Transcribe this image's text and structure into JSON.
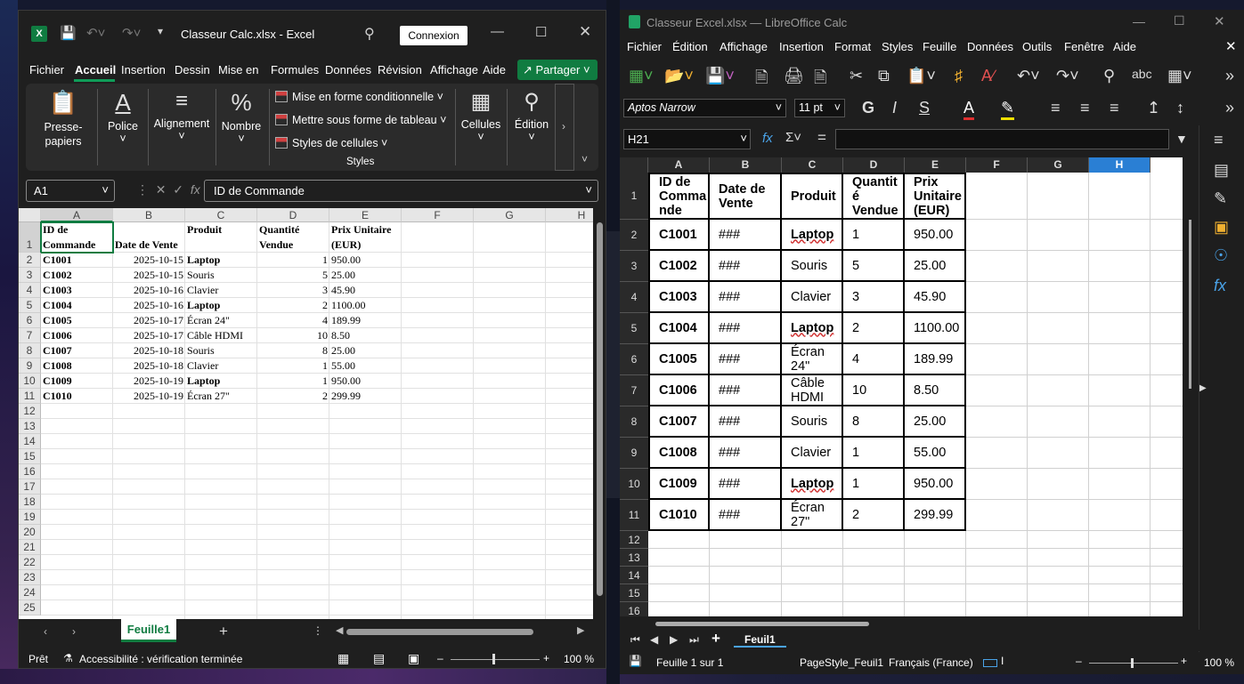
{
  "excel": {
    "app_icon_letter": "X",
    "file_title": "Classeur Calc.xlsx  -  Excel",
    "connexion_label": "Connexion",
    "menu": [
      "Fichier",
      "Accueil",
      "Insertion",
      "Dessin",
      "Mise en",
      "Formules",
      "Données",
      "Révision",
      "Affichage",
      "Aide"
    ],
    "share_label": "Partager",
    "ribbon": {
      "clipboard": "Presse-papiers",
      "font": "Police",
      "alignment": "Alignement",
      "number": "Nombre",
      "cond_format": "Mise en forme conditionnelle",
      "table_format": "Mettre sous forme de tableau",
      "cell_styles": "Styles de cellules",
      "styles_group": "Styles",
      "cells": "Cellules",
      "editing": "Édition"
    },
    "name_box": "A1",
    "formula": "ID de Commande",
    "columns": [
      "A",
      "B",
      "C",
      "D",
      "E",
      "F",
      "G",
      "H"
    ],
    "rows": [
      "1",
      "2",
      "3",
      "4",
      "5",
      "6",
      "7",
      "8",
      "9",
      "10",
      "11",
      "12",
      "13",
      "14",
      "15",
      "16",
      "17",
      "18",
      "19",
      "20",
      "21",
      "22",
      "23",
      "24",
      "25"
    ],
    "header_row": [
      "ID de Commande",
      "Date de Vente",
      "Produit",
      "Quantité Vendue",
      "Prix Unitaire (EUR)"
    ],
    "data": [
      [
        "C1001",
        "2025-10-15",
        "Laptop",
        "1",
        "950.00"
      ],
      [
        "C1002",
        "2025-10-15",
        "Souris",
        "5",
        "25.00"
      ],
      [
        "C1003",
        "2025-10-16",
        "Clavier",
        "3",
        "45.90"
      ],
      [
        "C1004",
        "2025-10-16",
        "Laptop",
        "2",
        "1100.00"
      ],
      [
        "C1005",
        "2025-10-17",
        "Écran 24\"",
        "4",
        "189.99"
      ],
      [
        "C1006",
        "2025-10-17",
        "Câble HDMI",
        "10",
        "8.50"
      ],
      [
        "C1007",
        "2025-10-18",
        "Souris",
        "8",
        "25.00"
      ],
      [
        "C1008",
        "2025-10-18",
        "Clavier",
        "1",
        "55.00"
      ],
      [
        "C1009",
        "2025-10-19",
        "Laptop",
        "1",
        "950.00"
      ],
      [
        "C1010",
        "2025-10-19",
        "Écran 27\"",
        "2",
        "299.99"
      ]
    ],
    "sheet_tab": "Feuille1",
    "status_ready": "Prêt",
    "status_accessibility": "Accessibilité : vérification terminée",
    "zoom": "100 %",
    "accent": "#107c41"
  },
  "calc": {
    "window_title": "Classeur Excel.xlsx — LibreOffice Calc",
    "menu": [
      "Fichier",
      "Édition",
      "Affichage",
      "Insertion",
      "Format",
      "Styles",
      "Feuille",
      "Données",
      "Outils",
      "Fenêtre",
      "Aide"
    ],
    "font_name": "Aptos Narrow",
    "font_size": "11 pt",
    "bold": "G",
    "italic": "I",
    "underline": "S",
    "name_box": "H21",
    "columns": [
      "A",
      "B",
      "C",
      "D",
      "E",
      "F",
      "G",
      "H"
    ],
    "rows": [
      "1",
      "2",
      "3",
      "4",
      "5",
      "6",
      "7",
      "8",
      "9",
      "10",
      "11",
      "12",
      "13",
      "14",
      "15",
      "16"
    ],
    "header_row": [
      "ID de Comma nde",
      "Date de Vente",
      "Produit",
      "Quantit é Vendue",
      "Prix Unitaire (EUR)"
    ],
    "date_placeholder": "###",
    "data": [
      [
        "C1001",
        "Laptop",
        "1",
        "950.00"
      ],
      [
        "C1002",
        "Souris",
        "5",
        "25.00"
      ],
      [
        "C1003",
        "Clavier",
        "3",
        "45.90"
      ],
      [
        "C1004",
        "Laptop",
        "2",
        "1100.00"
      ],
      [
        "C1005",
        "Écran 24\"",
        "4",
        "189.99"
      ],
      [
        "C1006",
        "Câble HDMI",
        "10",
        "8.50"
      ],
      [
        "C1007",
        "Souris",
        "8",
        "25.00"
      ],
      [
        "C1008",
        "Clavier",
        "1",
        "55.00"
      ],
      [
        "C1009",
        "Laptop",
        "1",
        "950.00"
      ],
      [
        "C1010",
        "Écran 27\"",
        "2",
        "299.99"
      ]
    ],
    "sheet_tab": "Feuil1",
    "status_sheet": "Feuille 1 sur 1",
    "status_pagestyle": "PageStyle_Feuil1",
    "status_lang": "Français (France)",
    "zoom": "100 %",
    "accent": "#2a7fd4"
  }
}
